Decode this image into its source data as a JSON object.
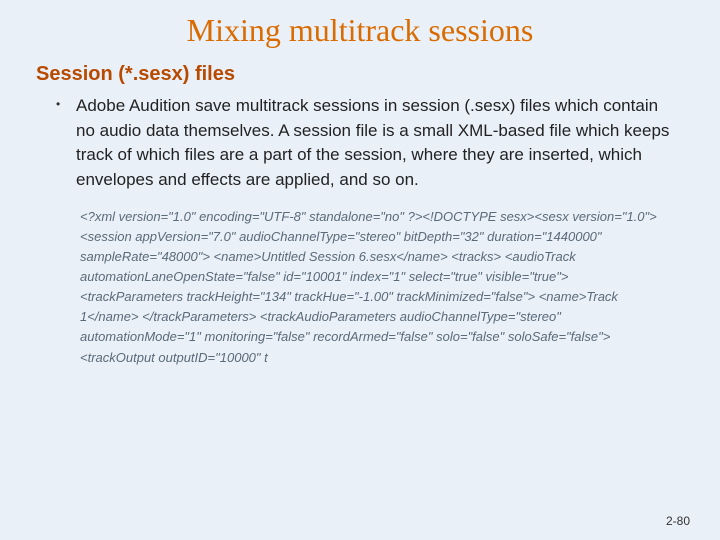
{
  "title": "Mixing multitrack sessions",
  "subhead": "Session (*.sesx) files",
  "bullet": "Adobe Audition save multitrack sessions in session (.sesx) files which contain no audio data themselves. A session file is a small XML-based file which keeps track of which files are a part of the session, where they are inserted, which envelopes and effects are applied, and so on.",
  "code": "<?xml version=\"1.0\" encoding=\"UTF-8\" standalone=\"no\" ?><!DOCTYPE sesx><sesx version=\"1.0\">   <session appVersion=\"7.0\" audioChannelType=\"stereo\" bitDepth=\"32\" duration=\"1440000\" sampleRate=\"48000\">     <name>Untitled Session 6.sesx</name>     <tracks>       <audioTrack automationLaneOpenState=\"false\" id=\"10001\" index=\"1\" select=\"true\" visible=\"true\">         <trackParameters trackHeight=\"134\" trackHue=\"-1.00\" trackMinimized=\"false\">           <name>Track 1</name>         </trackParameters>         <trackAudioParameters audioChannelType=\"stereo\" automationMode=\"1\" monitoring=\"false\" recordArmed=\"false\" solo=\"false\" soloSafe=\"false\">           <trackOutput outputID=\"10000\" t",
  "pagenum": "2-80"
}
